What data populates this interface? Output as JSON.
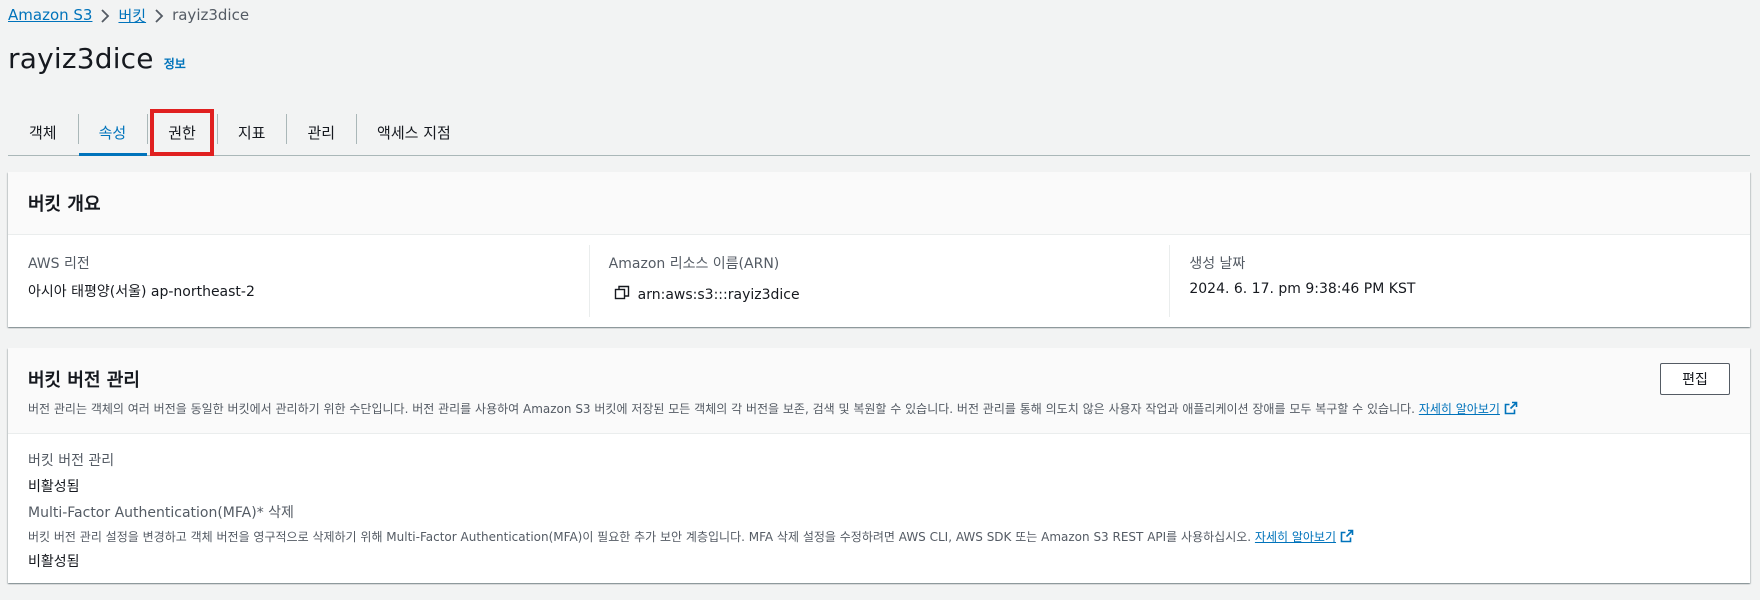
{
  "breadcrumb": {
    "items": [
      "Amazon S3",
      "버킷",
      "rayiz3dice"
    ]
  },
  "header": {
    "title": "rayiz3dice",
    "info_label": "정보"
  },
  "tabs": [
    {
      "label": "객체"
    },
    {
      "label": "속성"
    },
    {
      "label": "권한"
    },
    {
      "label": "지표"
    },
    {
      "label": "관리"
    },
    {
      "label": "액세스 지점"
    }
  ],
  "active_tab": "속성",
  "highlighted_tab": "권한",
  "highlight_color": "#e02020",
  "accent_color": "#0073bb",
  "overview": {
    "title": "버킷 개요",
    "region_label": "AWS 리전",
    "region_value": "아시아 태평양(서울) ap-northeast-2",
    "arn_label": "Amazon 리소스 이름(ARN)",
    "arn_value": "arn:aws:s3:::rayiz3dice",
    "arn_icon": "copy-icon",
    "created_label": "생성 날짜",
    "created_value": "2024. 6. 17. pm 9:38:46 PM KST"
  },
  "versioning": {
    "title": "버킷 버전 관리",
    "description": "버전 관리는 객체의 여러 버전을 동일한 버킷에서 관리하기 위한 수단입니다. 버전 관리를 사용하여 Amazon S3 버킷에 저장된 모든 객체의 각 버전을 보존, 검색 및 복원할 수 있습니다. 버전 관리를 통해 의도치 않은 사용자 작업과 애플리케이션 장애를 모두 복구할 수 있습니다.",
    "learn_more": "자세히 알아보기",
    "edit_label": "편집",
    "status_label": "버킷 버전 관리",
    "status_value": "비활성됨",
    "mfa_label": "Multi-Factor Authentication(MFA)* 삭제",
    "mfa_description": "버킷 버전 관리 설정을 변경하고 객체 버전을 영구적으로 삭제하기 위해 Multi-Factor Authentication(MFA)이 필요한 추가 보안 계층입니다. MFA 삭제 설정을 수정하려면 AWS CLI, AWS SDK 또는 Amazon S3 REST API를 사용하십시오.",
    "mfa_learn_more": "자세히 알아보기",
    "mfa_value": "비활성됨"
  }
}
